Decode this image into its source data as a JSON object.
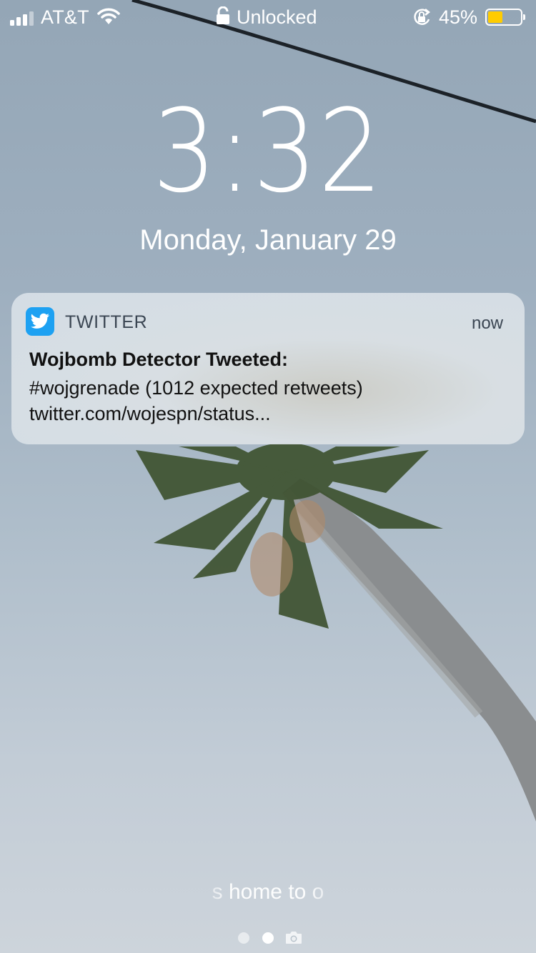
{
  "status_bar": {
    "carrier": "AT&T",
    "lock_label": "Unlocked",
    "battery_percent": "45%",
    "battery_level": 0.45,
    "battery_color": "#ffcc00",
    "signal_bars": 3,
    "icons": [
      "signal-icon",
      "wifi-icon",
      "lock-icon",
      "rotation-lock-icon",
      "battery-icon"
    ]
  },
  "clock": {
    "time": "3:32",
    "date": "Monday, January 29"
  },
  "notification": {
    "app_name": "TWITTER",
    "app_icon": "twitter-bird-icon",
    "app_color": "#1da1f2",
    "time": "now",
    "title": "Wojbomb Detector Tweeted:",
    "lines": [
      "#wojgrenade (1012 expected retweets)",
      "twitter.com/wojespn/status..."
    ]
  },
  "bottom": {
    "hint": "s home to o",
    "page_dots": 2,
    "active_page": 2,
    "camera_icon": "camera-icon"
  }
}
